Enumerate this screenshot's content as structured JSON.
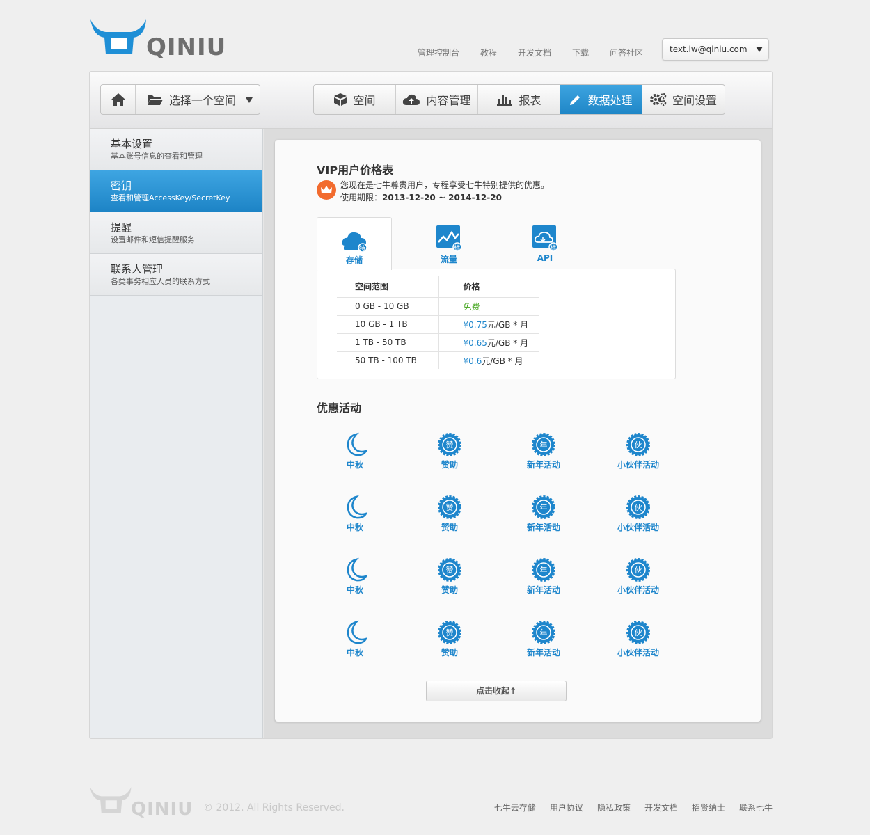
{
  "header": {
    "logo_text": "QINIU",
    "nav": [
      "管理控制台",
      "教程",
      "开发文档",
      "下载",
      "问答社区"
    ],
    "account": "text.lw@qiniu.com"
  },
  "toolbar": {
    "home": "",
    "bucket_select": "选择一个空间",
    "tabs": [
      {
        "label": "空间",
        "icon": "cube-icon"
      },
      {
        "label": "内容管理",
        "icon": "cloud-upload-icon"
      },
      {
        "label": "报表",
        "icon": "bar-chart-icon"
      },
      {
        "label": "数据处理",
        "icon": "pencil-icon",
        "active": true
      },
      {
        "label": "空间设置",
        "icon": "gears-icon"
      }
    ]
  },
  "sidebar": {
    "items": [
      {
        "title": "基本设置",
        "sub": "基本账号信息的查看和管理"
      },
      {
        "title": "密钥",
        "sub": "查看和管理AccessKey/SecretKey",
        "active": true
      },
      {
        "title": "提醒",
        "sub": "设置邮件和短信提醒服务"
      },
      {
        "title": "联系人管理",
        "sub": "各类事务相应人员的联系方式"
      }
    ]
  },
  "vip": {
    "title": "VIP用户价格表",
    "line1": "您现在是七牛尊贵用户，专程享受七牛特别提供的优惠。",
    "period_label": "使用期限：",
    "period_value": "2013-12-20 ~ 2014-12-20"
  },
  "price_tabs": [
    {
      "label": "存储",
      "badge": "特"
    },
    {
      "label": "流量",
      "badge": "标"
    },
    {
      "label": "API",
      "badge": "标"
    }
  ],
  "price_table": {
    "headers": [
      "空间范围",
      "价格"
    ],
    "rows": [
      {
        "range": "0 GB - 10 GB",
        "price_free": "免费"
      },
      {
        "range": "10 GB - 1 TB",
        "currency": "¥",
        "num": "0.75",
        "unit": "元/GB * 月"
      },
      {
        "range": "1 TB - 50 TB",
        "currency": "¥",
        "num": "0.65",
        "unit": "元/GB * 月"
      },
      {
        "range": "50 TB - 100 TB",
        "currency": "¥",
        "num": "0.6",
        "unit": "元/GB * 月"
      }
    ]
  },
  "promo": {
    "title": "优惠活动",
    "labels": [
      "中秋",
      "赞助",
      "新年活动",
      "小伙伴活动"
    ],
    "badge_chars": [
      "",
      "赞",
      "年",
      "伙"
    ],
    "collapse": "点击收起↑"
  },
  "footer": {
    "logo_text": "QINIU",
    "copyright": "© 2012. All Rights Reserved.",
    "links": [
      "七牛云存储",
      "用户协议",
      "隐私政策",
      "开发文档",
      "招贤纳士",
      "联系七牛"
    ]
  },
  "colors": {
    "accent": "#1e86cc",
    "free": "#42a51b",
    "badge": "#f26b2e"
  }
}
